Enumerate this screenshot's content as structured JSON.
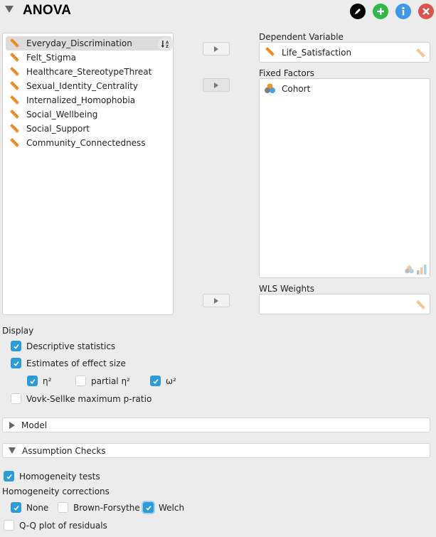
{
  "header": {
    "title": "ANOVA",
    "buttons": [
      {
        "name": "edit-title-button",
        "icon": "pencil-icon",
        "color": "#000000"
      },
      {
        "name": "add-analysis-button",
        "icon": "plus-icon",
        "color": "#2eb845"
      },
      {
        "name": "info-button",
        "icon": "info-icon",
        "color": "#3d98e8"
      },
      {
        "name": "close-button",
        "icon": "close-icon",
        "color": "#d9534f"
      }
    ]
  },
  "variables": {
    "items": [
      {
        "label": "Everyday_Discrimination",
        "type": "scale",
        "selected": true
      },
      {
        "label": "Felt_Stigma",
        "type": "scale"
      },
      {
        "label": "Healthcare_StereotypeThreat",
        "type": "scale"
      },
      {
        "label": "Sexual_Identity_Centrality",
        "type": "scale"
      },
      {
        "label": "Internalized_Homophobia",
        "type": "scale"
      },
      {
        "label": "Social_Wellbeing",
        "type": "scale"
      },
      {
        "label": "Social_Support",
        "type": "scale"
      },
      {
        "label": "Community_Connectedness",
        "type": "scale"
      }
    ],
    "sort_icon": "sort-az-icon"
  },
  "targets": {
    "dependent": {
      "label": "Dependent Variable",
      "value": "Life_Satisfaction"
    },
    "fixed_factors": {
      "label": "Fixed Factors",
      "items": [
        "Cohort"
      ]
    },
    "wls_weights": {
      "label": "WLS Weights",
      "value": ""
    }
  },
  "display": {
    "label": "Display",
    "descriptive": {
      "label": "Descriptive statistics",
      "checked": true
    },
    "effect_size": {
      "label": "Estimates of effect size",
      "checked": true
    },
    "eta2": {
      "label": "η²",
      "checked": true
    },
    "partial_eta2": {
      "label": "partial η²",
      "checked": false
    },
    "omega2": {
      "label": "ω²",
      "checked": true
    },
    "vovk": {
      "label": "Vovk-Sellke maximum p-ratio",
      "checked": false
    }
  },
  "sections": {
    "model": {
      "label": "Model",
      "expanded": false
    },
    "assumptions": {
      "label": "Assumption Checks",
      "expanded": true
    }
  },
  "assumptions": {
    "homogeneity_tests": {
      "label": "Homogeneity tests",
      "checked": true
    },
    "corrections_label": "Homogeneity corrections",
    "none": {
      "label": "None",
      "checked": true
    },
    "brown_forsythe": {
      "label": "Brown-Forsythe",
      "checked": false
    },
    "welch": {
      "label": "Welch",
      "checked": true
    },
    "qq": {
      "label": "Q-Q plot of residuals",
      "checked": false
    }
  }
}
